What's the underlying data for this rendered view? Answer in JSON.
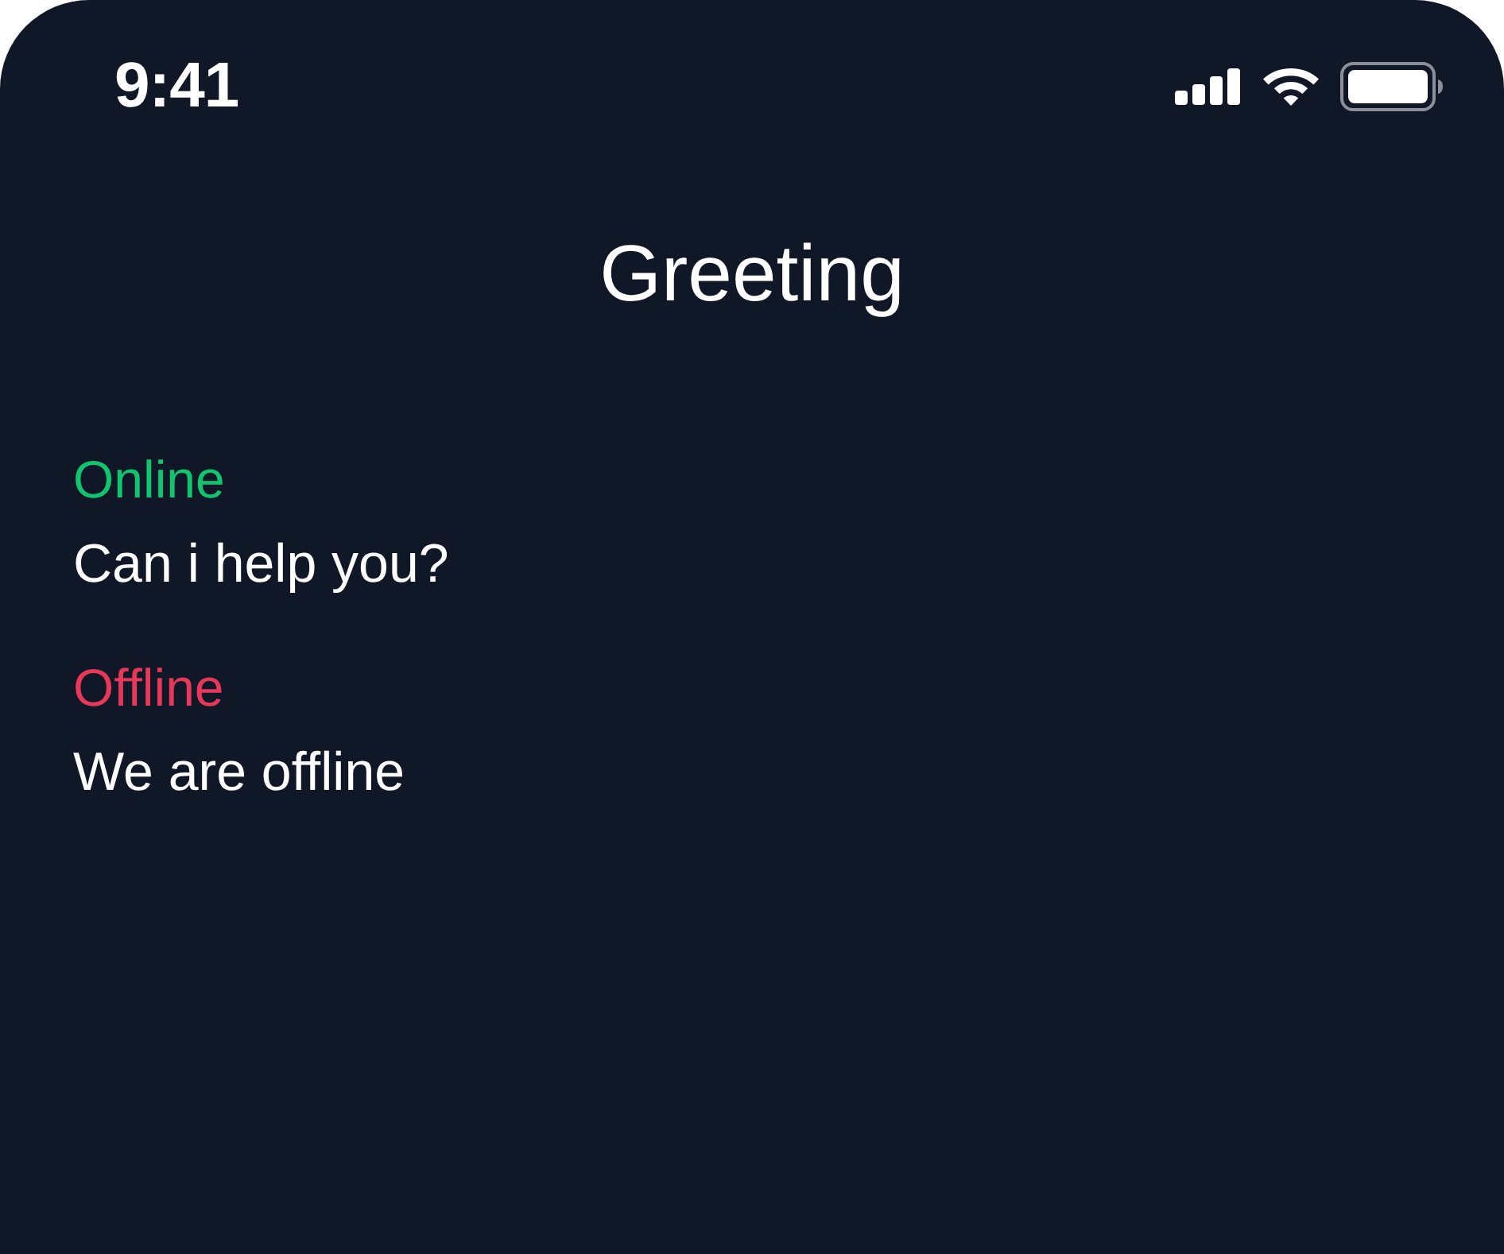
{
  "status_bar": {
    "time": "9:41"
  },
  "header": {
    "title": "Greeting"
  },
  "messages": [
    {
      "status": "Online",
      "color": "#12c46e",
      "text": "Can i help you?"
    },
    {
      "status": "Offline",
      "color": "#e8385a",
      "text": "We are offline"
    }
  ]
}
